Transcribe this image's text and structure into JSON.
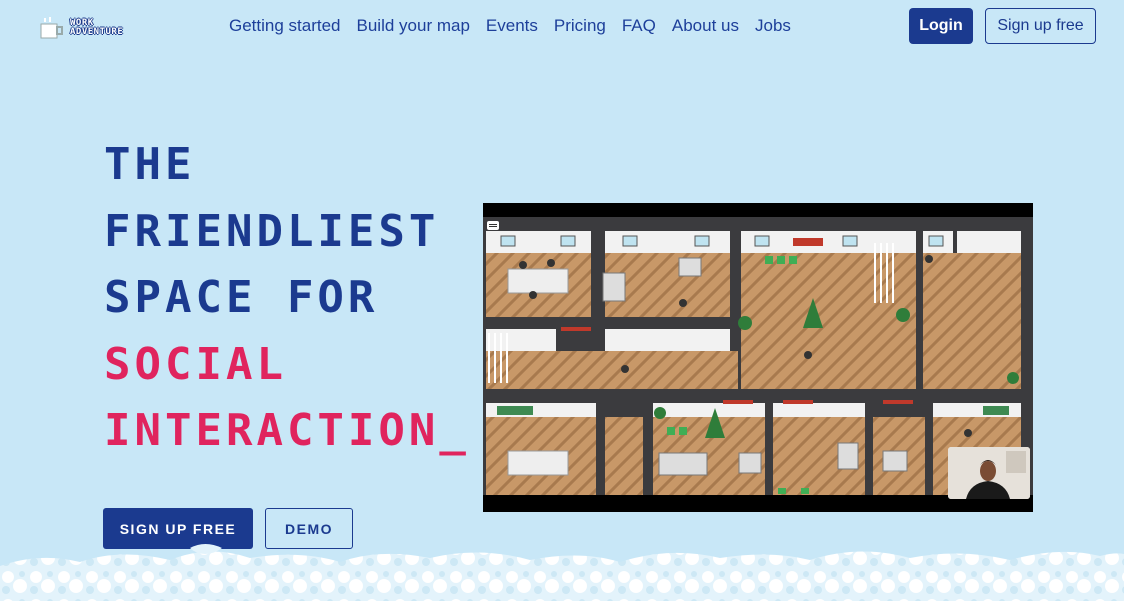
{
  "brand": {
    "logo_line1": "WORK",
    "logo_line2": "ADVENTURE"
  },
  "nav": {
    "items": [
      "Getting started",
      "Build your map",
      "Events",
      "Pricing",
      "FAQ",
      "About us",
      "Jobs"
    ],
    "login_label": "Login",
    "signup_label": "Sign up free"
  },
  "hero": {
    "title_line1": "THE",
    "title_line2": "FRIENDLIEST",
    "title_line3": "SPACE FOR",
    "title_line4": "SOCIAL",
    "title_line5": "INTERACTION_",
    "primary_cta": "SIGN UP FREE",
    "secondary_cta": "DEMO"
  },
  "colors": {
    "background": "#c8e7f7",
    "brand_blue": "#1b3a8f",
    "accent_pink": "#e0245e"
  }
}
